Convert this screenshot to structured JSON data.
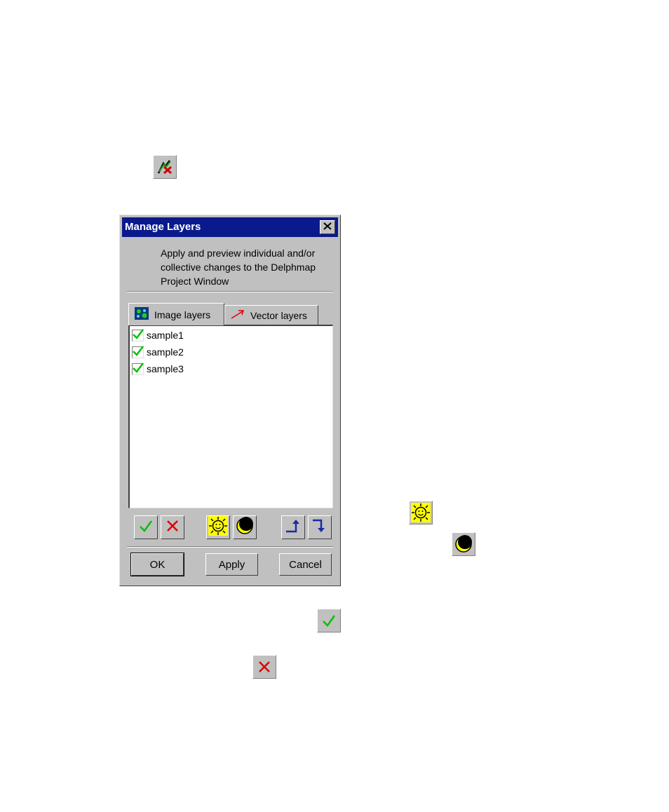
{
  "dialog": {
    "title": "Manage Layers",
    "description": "Apply and preview individual and/or collective changes to the Delphmap Project Window",
    "tabs": [
      {
        "label": "Image layers",
        "icon": "image-layers-icon",
        "selected": true
      },
      {
        "label": "Vector layers",
        "icon": "vector-arrow-icon",
        "selected": false
      }
    ],
    "layers": [
      {
        "name": "sample1",
        "checked": true
      },
      {
        "name": "sample2",
        "checked": true
      },
      {
        "name": "sample3",
        "checked": true
      }
    ],
    "toolbar": [
      "check-all-icon",
      "uncheck-all-icon",
      "show-all-sun-icon",
      "hide-all-moon-icon",
      "move-up-icon",
      "move-down-icon"
    ],
    "buttons": {
      "ok": "OK",
      "apply": "Apply",
      "cancel": "Cancel"
    }
  },
  "standalone_icons": [
    "manage-layers-tool-icon",
    "sun-icon",
    "moon-icon",
    "check-icon",
    "cross-icon"
  ],
  "colors": {
    "titlebar": "#0a1a8c",
    "face": "#c0c0c0",
    "check": "#00c000",
    "cross": "#e00000",
    "sun": "#ffff00"
  }
}
